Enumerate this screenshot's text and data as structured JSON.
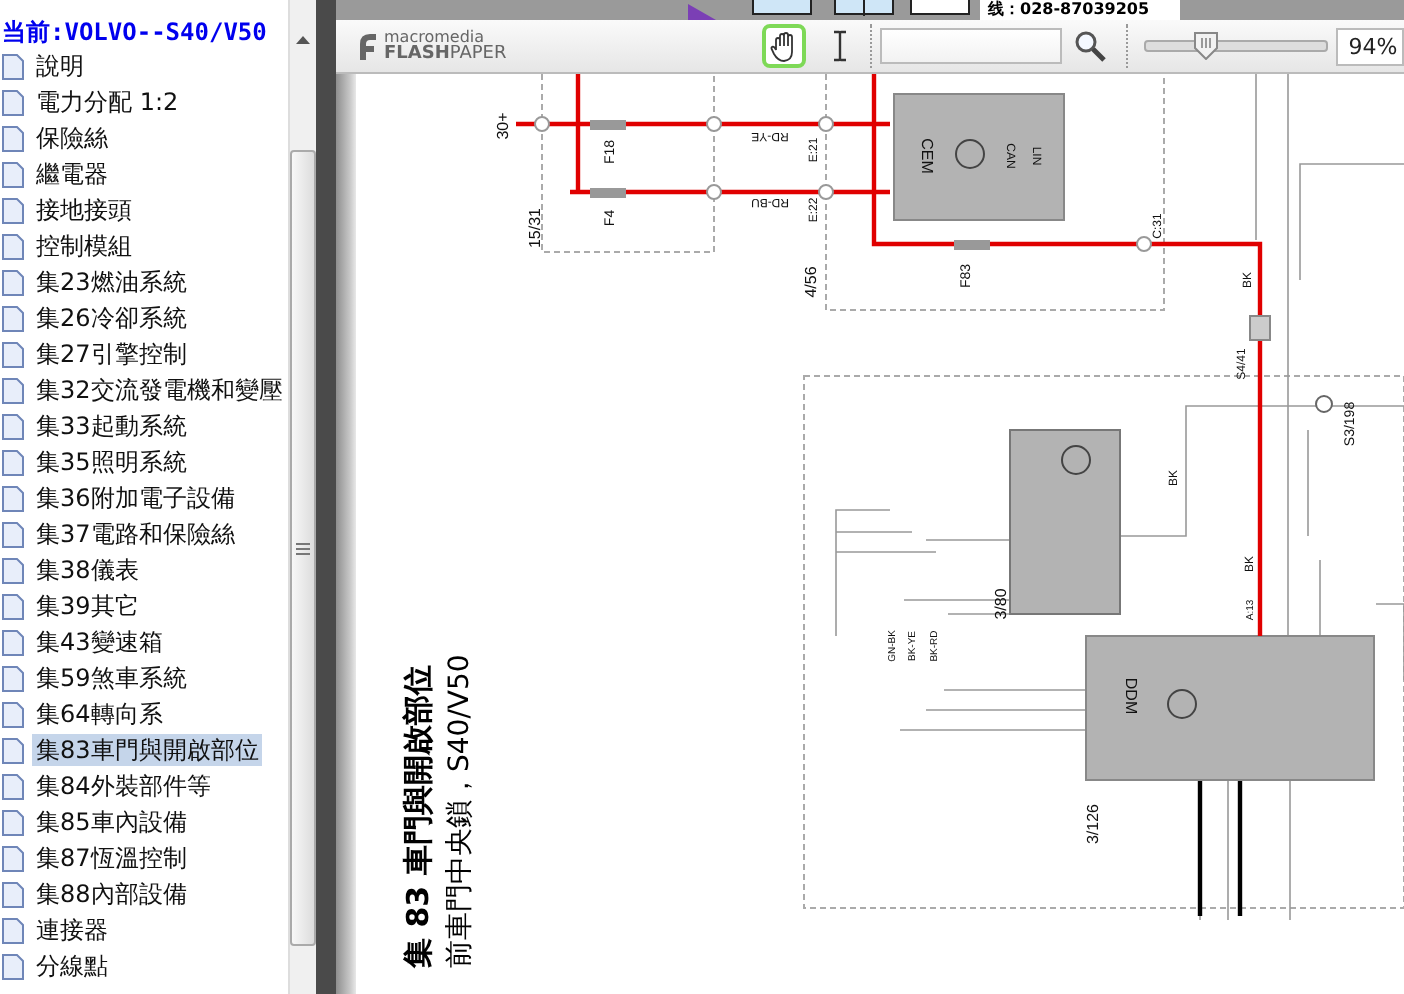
{
  "banner": {
    "phone": "线：028-87039205"
  },
  "sidebar": {
    "header": "当前:VOLVO--S40/V50",
    "items": [
      {
        "label": "說明",
        "selected": false
      },
      {
        "label": "電力分配 1:2",
        "selected": false
      },
      {
        "label": "保險絲",
        "selected": false
      },
      {
        "label": "繼電器",
        "selected": false
      },
      {
        "label": "接地接頭",
        "selected": false
      },
      {
        "label": "控制模組",
        "selected": false
      },
      {
        "label": "集23燃油系統",
        "selected": false
      },
      {
        "label": "集26冷卻系統",
        "selected": false
      },
      {
        "label": "集27引擎控制",
        "selected": false
      },
      {
        "label": "集32交流發電機和變壓",
        "selected": false
      },
      {
        "label": "集33起動系統",
        "selected": false
      },
      {
        "label": "集35照明系統",
        "selected": false
      },
      {
        "label": "集36附加電子設備",
        "selected": false
      },
      {
        "label": "集37電路和保險絲",
        "selected": false
      },
      {
        "label": "集38儀表",
        "selected": false
      },
      {
        "label": "集39其它",
        "selected": false
      },
      {
        "label": "集43變速箱",
        "selected": false
      },
      {
        "label": "集59煞車系統",
        "selected": false
      },
      {
        "label": "集64轉向系",
        "selected": false
      },
      {
        "label": "集83車門與開啟部位",
        "selected": true
      },
      {
        "label": "集84外裝部件等",
        "selected": false
      },
      {
        "label": "集85車內設備",
        "selected": false
      },
      {
        "label": "集87恆溫控制",
        "selected": false
      },
      {
        "label": "集88內部設備",
        "selected": false
      },
      {
        "label": "連接器",
        "selected": false
      },
      {
        "label": "分線點",
        "selected": false
      }
    ]
  },
  "toolbar": {
    "logo_top": "macromedia",
    "logo_bottom": "**FLASH**PAPER",
    "tools": [
      {
        "kind": "hand",
        "selected": true
      },
      {
        "kind": "text",
        "selected": false
      }
    ],
    "zoom": {
      "level": 0.33,
      "value": "94%"
    }
  },
  "document": {
    "title": "集 83 車門與開啟部位",
    "subtitle": "前車門中央鎖，S40/V50",
    "labels": [
      {
        "text": "30+"
      },
      {
        "text": "15/31"
      },
      {
        "text": "F18"
      },
      {
        "text": "F4"
      },
      {
        "text": "RD-YE"
      },
      {
        "text": "RD-BU"
      },
      {
        "text": "E:21"
      },
      {
        "text": "E:22"
      },
      {
        "text": "4/56"
      },
      {
        "text": "CEM"
      },
      {
        "text": "CAN"
      },
      {
        "text": "LIN"
      },
      {
        "text": "F83"
      },
      {
        "text": "C:31"
      },
      {
        "text": "BK"
      },
      {
        "text": "S4/41"
      },
      {
        "text": "BK"
      },
      {
        "text": "3/80"
      },
      {
        "text": "GN-BK"
      },
      {
        "text": "BK-YE"
      },
      {
        "text": "BK-RD"
      },
      {
        "text": "BK"
      },
      {
        "text": "A:13"
      },
      {
        "text": "S3/198"
      },
      {
        "text": "DDM"
      },
      {
        "text": "3/126"
      }
    ]
  }
}
